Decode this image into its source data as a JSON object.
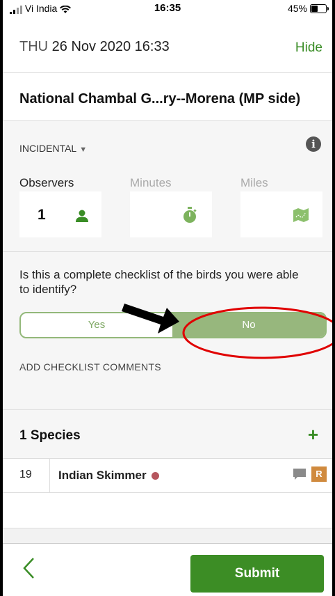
{
  "status_bar": {
    "carrier": "Vi India",
    "time": "16:35",
    "battery_pct": "45%"
  },
  "header": {
    "day": "THU",
    "datetime": "26 Nov 2020 16:33",
    "hide_label": "Hide"
  },
  "location": {
    "name": "National Chambal G...ry--Morena (MP side)"
  },
  "protocol": {
    "label": "INCIDENTAL",
    "caret": "▼"
  },
  "fields": {
    "observers": {
      "label": "Observers",
      "value": "1"
    },
    "minutes": {
      "label": "Minutes"
    },
    "miles": {
      "label": "Miles"
    }
  },
  "complete": {
    "question": "Is this a complete checklist of the birds you were able to identify?",
    "yes_label": "Yes",
    "no_label": "No"
  },
  "comments_label": "ADD CHECKLIST COMMENTS",
  "species": {
    "count_label": "1 Species",
    "add_symbol": "+",
    "items": [
      {
        "count": "19",
        "name": "Indian Skimmer",
        "badge": "R"
      }
    ]
  },
  "footer": {
    "back_symbol": "<",
    "submit_label": "Submit"
  },
  "colors": {
    "accent": "#3a8d26",
    "toggle_selected": "#97b77d",
    "rare_badge": "#d08a3e",
    "annotation": "#e00000"
  },
  "icons": [
    "signal-icon",
    "wifi-icon",
    "battery-icon",
    "info-icon",
    "person-icon",
    "stopwatch-icon",
    "map-icon",
    "comment-icon",
    "back-chevron-icon"
  ]
}
